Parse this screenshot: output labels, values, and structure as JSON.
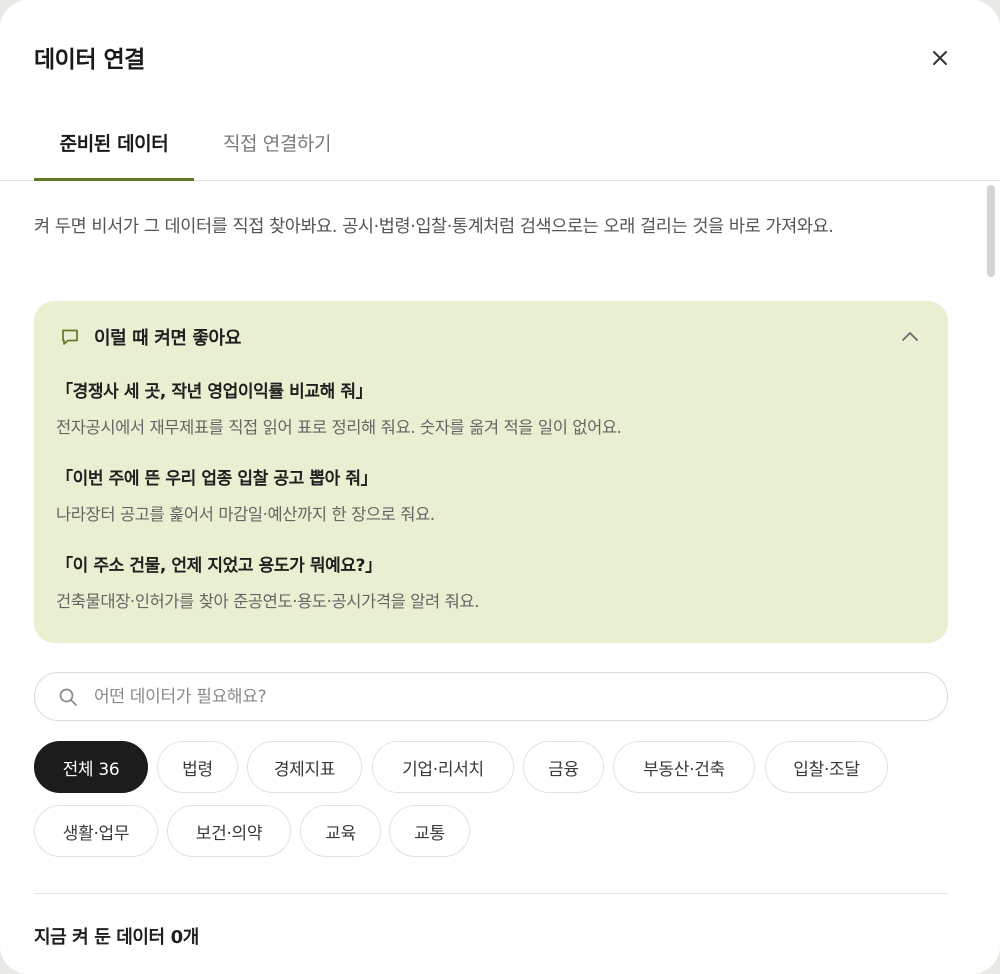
{
  "dialog": {
    "title": "데이터 연결",
    "close_icon": "close-icon"
  },
  "tabs": [
    {
      "label": "준비된 데이터",
      "active": true
    },
    {
      "label": "직접 연결하기",
      "active": false
    }
  ],
  "intro": "켜 두면 비서가 그 데이터를 직접 찾아봐요. 공시·법령·입찰·통계처럼 검색으로는 오래 걸리는 것을 바로 가져와요.",
  "tips": {
    "icon": "chat-bubble-icon",
    "title": "이럴 때 켜면 좋아요",
    "collapse_icon": "chevron-up-icon",
    "items": [
      {
        "question": "「경쟁사 세 곳, 작년 영업이익률 비교해 줘」",
        "answer": "전자공시에서 재무제표를 직접 읽어 표로 정리해 줘요. 숫자를 옮겨 적을 일이 없어요."
      },
      {
        "question": "「이번 주에 뜬 우리 업종 입찰 공고 뽑아 줘」",
        "answer": "나라장터 공고를 훑어서 마감일·예산까지 한 장으로 줘요."
      },
      {
        "question": "「이 주소 건물, 언제 지었고 용도가 뭐예요?」",
        "answer": "건축물대장·인허가를 찾아 준공연도·용도·공시가격을 알려 줘요."
      }
    ]
  },
  "search": {
    "icon": "search-icon",
    "placeholder": "어떤 데이터가 필요해요?",
    "value": ""
  },
  "filters": [
    {
      "label": "전체 36",
      "active": true
    },
    {
      "label": "법령",
      "active": false
    },
    {
      "label": "경제지표",
      "active": false
    },
    {
      "label": "기업·리서치",
      "active": false
    },
    {
      "label": "금융",
      "active": false
    },
    {
      "label": "부동산·건축",
      "active": false
    },
    {
      "label": "입찰·조달",
      "active": false
    },
    {
      "label": "생활·업무",
      "active": false
    },
    {
      "label": "보건·의약",
      "active": false
    },
    {
      "label": "교육",
      "active": false
    },
    {
      "label": "교통",
      "active": false
    }
  ],
  "connected_count_label": "지금 켜 둔 데이터 0개",
  "colors": {
    "accent": "#5e7b24",
    "tips_background": "#e9f0d2",
    "active_chip": "#1c1c1c"
  }
}
